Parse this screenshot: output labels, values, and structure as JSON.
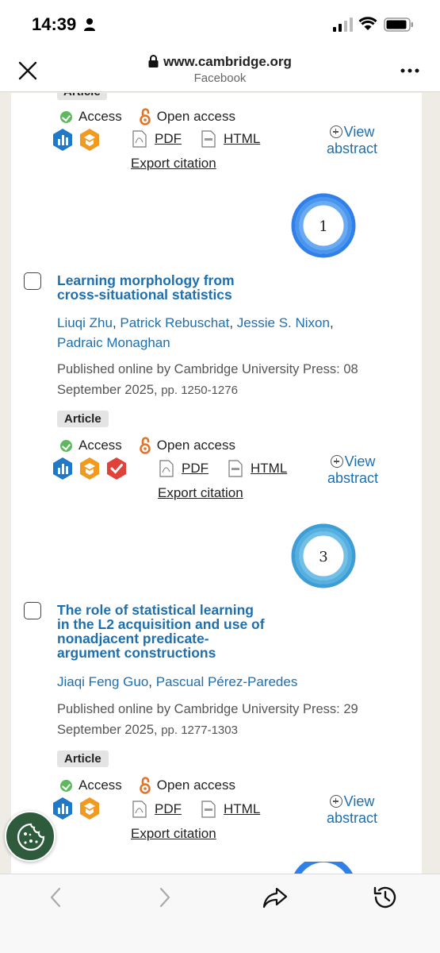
{
  "status_bar": {
    "time": "14:39"
  },
  "browser": {
    "url": "www.cambridge.org",
    "source": "Facebook"
  },
  "colors": {
    "link": "#1e6fae",
    "badge_bg": "#e4e4e4",
    "altmetric_blue": "#3a8ee0",
    "cookie_bg": "#2d5b3c"
  },
  "labels": {
    "access": "Access",
    "open_access": "Open access",
    "pdf": "PDF",
    "html": "HTML",
    "export_citation": "Export citation",
    "view": "View",
    "abstract": "abstract",
    "article": "Article"
  },
  "top_partial": {
    "badge": "Article"
  },
  "articles": [
    {
      "altmetric_score": "1",
      "title_lines": [
        "Learning morphology from",
        "cross-situational statistics"
      ],
      "authors": [
        "Liuqi Zhu",
        "Patrick Rebuschat",
        "Jessie S. Nixon",
        "Padraic Monaghan"
      ],
      "published_lines": [
        "Published online by Cambridge University Press: 08",
        "September 2025,"
      ],
      "pages": "pp. 1250-1276",
      "type": "Article"
    },
    {
      "altmetric_score": "3",
      "title_lines": [
        "The role of statistical learning",
        "in the L2 acquisition and use of",
        "nonadjacent predicate-",
        "argument constructions"
      ],
      "authors": [
        "Jiaqi Feng Guo",
        "Pascual Pérez-Paredes"
      ],
      "published_lines": [
        "Published online by Cambridge University Press: 29",
        "September 2025,"
      ],
      "pages": "pp. 1277-1303",
      "type": "Article"
    }
  ],
  "icons": {
    "status": [
      "person-icon",
      "signal-icon",
      "wifi-icon",
      "battery-icon"
    ],
    "toolbar": [
      "back-icon",
      "forward-icon",
      "share-icon",
      "history-icon"
    ],
    "metrics": [
      "metrics-icon",
      "open-research-icon",
      "open-data-icon"
    ]
  }
}
